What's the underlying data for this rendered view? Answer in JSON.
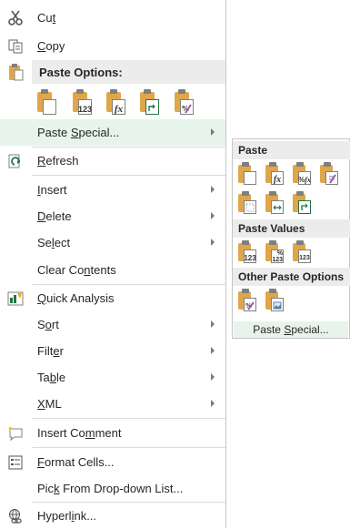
{
  "menu": {
    "cut": {
      "pre": "Cu",
      "key": "t",
      "post": ""
    },
    "copy": {
      "pre": "",
      "key": "C",
      "post": "opy"
    },
    "paste_options_header": "Paste Options:",
    "paste_options_icons": [
      "paste-icon",
      "paste-values-icon",
      "paste-formulas-icon",
      "paste-transpose-icon",
      "paste-formatting-icon"
    ],
    "paste_values_badge": "123",
    "paste_formulas_badge": "fx",
    "paste_special": {
      "pre": "Paste ",
      "key": "S",
      "post": "pecial..."
    },
    "refresh": {
      "pre": "",
      "key": "R",
      "post": "efresh"
    },
    "insert": {
      "pre": "",
      "key": "I",
      "post": "nsert"
    },
    "delete": {
      "pre": "",
      "key": "D",
      "post": "elete"
    },
    "select": {
      "pre": "Se",
      "key": "l",
      "post": "ect"
    },
    "clear_contents": {
      "pre": "Clear Co",
      "key": "n",
      "post": "tents"
    },
    "quick_analysis": {
      "pre": "",
      "key": "Q",
      "post": "uick Analysis"
    },
    "sort": {
      "pre": "S",
      "key": "o",
      "post": "rt"
    },
    "filter": {
      "pre": "Filt",
      "key": "e",
      "post": "r"
    },
    "table": {
      "pre": "Ta",
      "key": "b",
      "post": "le"
    },
    "xml": {
      "pre": "",
      "key": "X",
      "post": "ML"
    },
    "insert_comment": {
      "pre": "Insert Co",
      "key": "m",
      "post": "ment"
    },
    "format_cells": {
      "pre": "",
      "key": "F",
      "post": "ormat Cells..."
    },
    "pick_list": {
      "pre": "Pic",
      "key": "k",
      "post": " From Drop-down List..."
    },
    "hyperlink": {
      "pre": "Hyperl",
      "key": "i",
      "post": "nk..."
    }
  },
  "submenu": {
    "paste_header": "Paste",
    "paste_values_header": "Paste Values",
    "other_header": "Other Paste Options",
    "badge_123": "123",
    "badge_fx": "fx",
    "badge_pct": "%",
    "paste_special": {
      "pre": "Paste ",
      "key": "S",
      "post": "pecial..."
    }
  },
  "colors": {
    "accent_green": "#217346",
    "highlight": "#e7f4ec",
    "header_bg": "#ececec",
    "clipboard": "#e0a64a"
  }
}
